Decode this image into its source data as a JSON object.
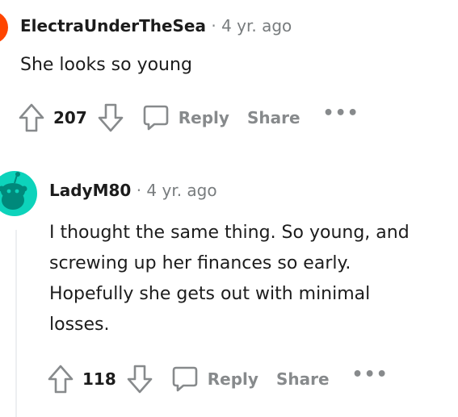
{
  "comments": [
    {
      "author": "ElectraUnderTheSea",
      "separator": "·",
      "age": "4 yr. ago",
      "body": [
        "She looks so young"
      ],
      "score": "207",
      "reply_label": "Reply",
      "share_label": "Share",
      "more_label": "•••"
    },
    {
      "author": "LadyM80",
      "separator": "·",
      "age": "4 yr. ago",
      "body": [
        "I thought the same thing. So young, and",
        "screwing up her finances so early.",
        "Hopefully she gets out with minimal",
        "losses."
      ],
      "score": "118",
      "reply_label": "Reply",
      "share_label": "Share",
      "more_label": "•••"
    }
  ],
  "icons": {
    "upvote": "upvote-arrow-icon",
    "downvote": "downvote-arrow-icon",
    "reply": "speech-bubble-icon",
    "more": "horizontal-ellipsis-icon",
    "avatar": "snoo-avatar-icon"
  },
  "colors": {
    "text": "#1c1c1c",
    "meta": "#787c7e",
    "action": "#878a8c",
    "avatar_teal": "#0dd3bb",
    "avatar_orange": "#ff4500"
  }
}
